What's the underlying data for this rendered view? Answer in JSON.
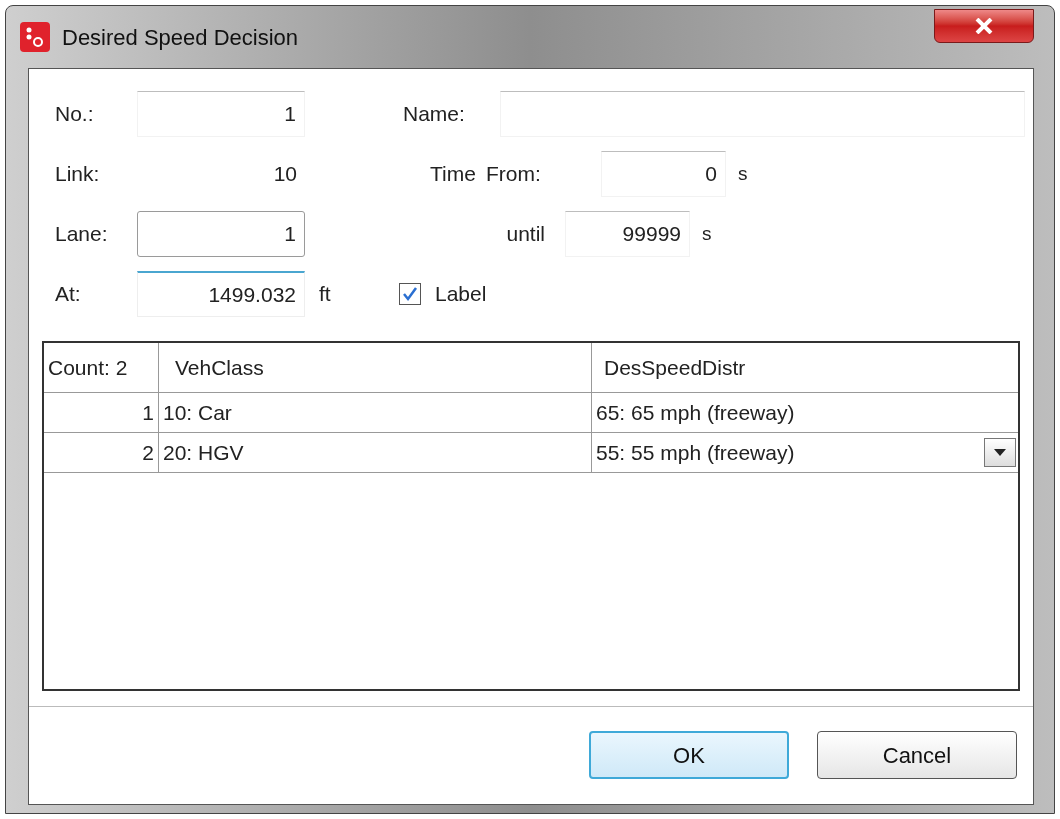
{
  "window": {
    "title": "Desired Speed Decision"
  },
  "no": {
    "label": "No.:",
    "value": "1"
  },
  "name": {
    "label": "Name:"
  },
  "link": {
    "label": "Link:",
    "value": "10"
  },
  "time_from": {
    "label_1": "Time",
    "label_2": "From:",
    "value": "0",
    "unit": "s"
  },
  "lane": {
    "label": "Lane:",
    "value": "1"
  },
  "until": {
    "label": "until",
    "value": "99999",
    "unit": "s"
  },
  "at": {
    "label": "At:",
    "value": "1499.032",
    "unit": "ft"
  },
  "label_checkbox": {
    "label": "Label",
    "checked": true
  },
  "table": {
    "columns": [
      "Count: 2",
      "VehClass",
      "DesSpeedDistr"
    ],
    "rows": [
      {
        "index": "1",
        "veh_class": "10: Car",
        "des_speed_distr": "65: 65 mph (freeway)",
        "dropdown": false
      },
      {
        "index": "2",
        "veh_class": "20: HGV",
        "des_speed_distr": "55: 55 mph (freeway)",
        "dropdown": true
      }
    ]
  },
  "buttons": [
    {
      "label": "OK",
      "default": true
    },
    {
      "label": "Cancel",
      "default": false
    }
  ]
}
